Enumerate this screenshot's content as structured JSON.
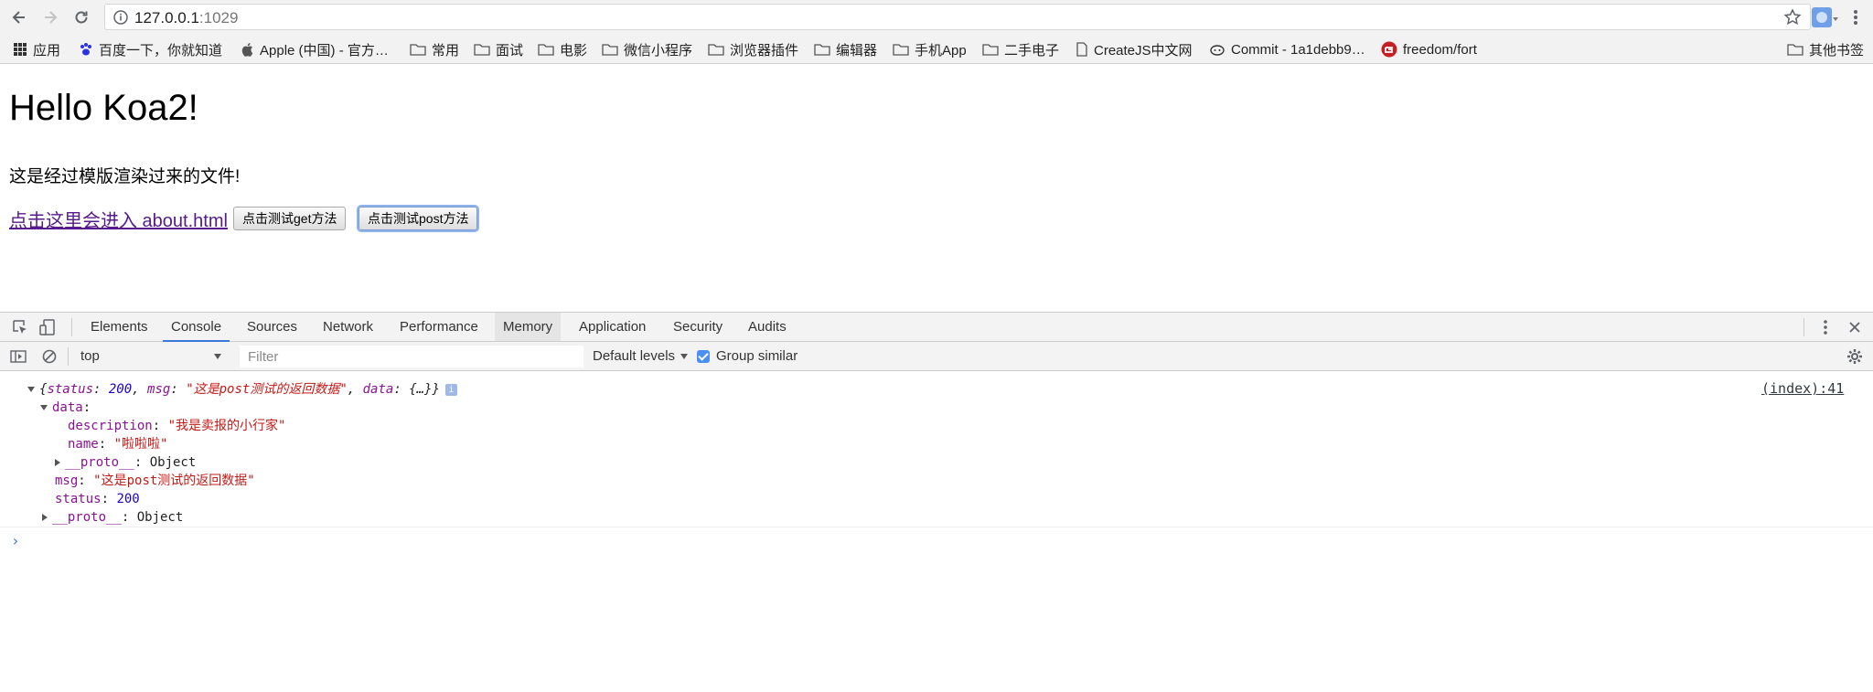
{
  "browser": {
    "url_host": "127.0.0.1",
    "url_port": ":1029"
  },
  "bookmarks": {
    "items": [
      {
        "label": "应用",
        "icon": "apps-grid-icon"
      },
      {
        "label": "百度一下，你就知道",
        "icon": "baidu-paw-icon"
      },
      {
        "label": "Apple (中国) - 官方…",
        "icon": "apple-logo-icon"
      },
      {
        "label": "常用",
        "icon": "folder-icon"
      },
      {
        "label": "面试",
        "icon": "folder-icon"
      },
      {
        "label": "电影",
        "icon": "folder-icon"
      },
      {
        "label": "微信小程序",
        "icon": "folder-icon"
      },
      {
        "label": "浏览器插件",
        "icon": "folder-icon"
      },
      {
        "label": "编辑器",
        "icon": "folder-icon"
      },
      {
        "label": "手机App",
        "icon": "folder-icon"
      },
      {
        "label": "二手电子",
        "icon": "folder-icon"
      },
      {
        "label": "CreateJS中文网",
        "icon": "page-icon"
      },
      {
        "label": "Commit - 1a1debb9…",
        "icon": "octocat-icon"
      },
      {
        "label": "freedom/fort",
        "icon": "gitee-icon"
      }
    ],
    "other": "其他书签"
  },
  "page": {
    "title": "Hello Koa2!",
    "description": "这是经过模版渲染过来的文件!",
    "about_link": "点击这里会进入 about.html",
    "get_button": "点击测试get方法",
    "post_button": "点击测试post方法"
  },
  "devtools": {
    "tabs": [
      "Elements",
      "Console",
      "Sources",
      "Network",
      "Performance",
      "Memory",
      "Application",
      "Security",
      "Audits"
    ],
    "active_tab": "Console",
    "context": "top",
    "filter_placeholder": "Filter",
    "levels": "Default levels",
    "group_similar": "Group similar",
    "accent": "#3879d9"
  },
  "console": {
    "summary": {
      "open": "{",
      "status_key": "status",
      "status_val": "200",
      "msg_key": "msg",
      "msg_val": "\"这是post测试的返回数据\"",
      "data_key": "data",
      "data_val": "{…}",
      "close": "}"
    },
    "source": "(index):41",
    "data_label": "data",
    "description_key": "description",
    "description_val": "\"我是卖报的小行家\"",
    "name_key": "name",
    "name_val": "\"啦啦啦\"",
    "proto_key": "__proto__",
    "proto_val": "Object",
    "msg_key": "msg",
    "msg_val": "\"这是post测试的返回数据\"",
    "status_key": "status",
    "status_val": "200",
    "prompt": "›"
  }
}
